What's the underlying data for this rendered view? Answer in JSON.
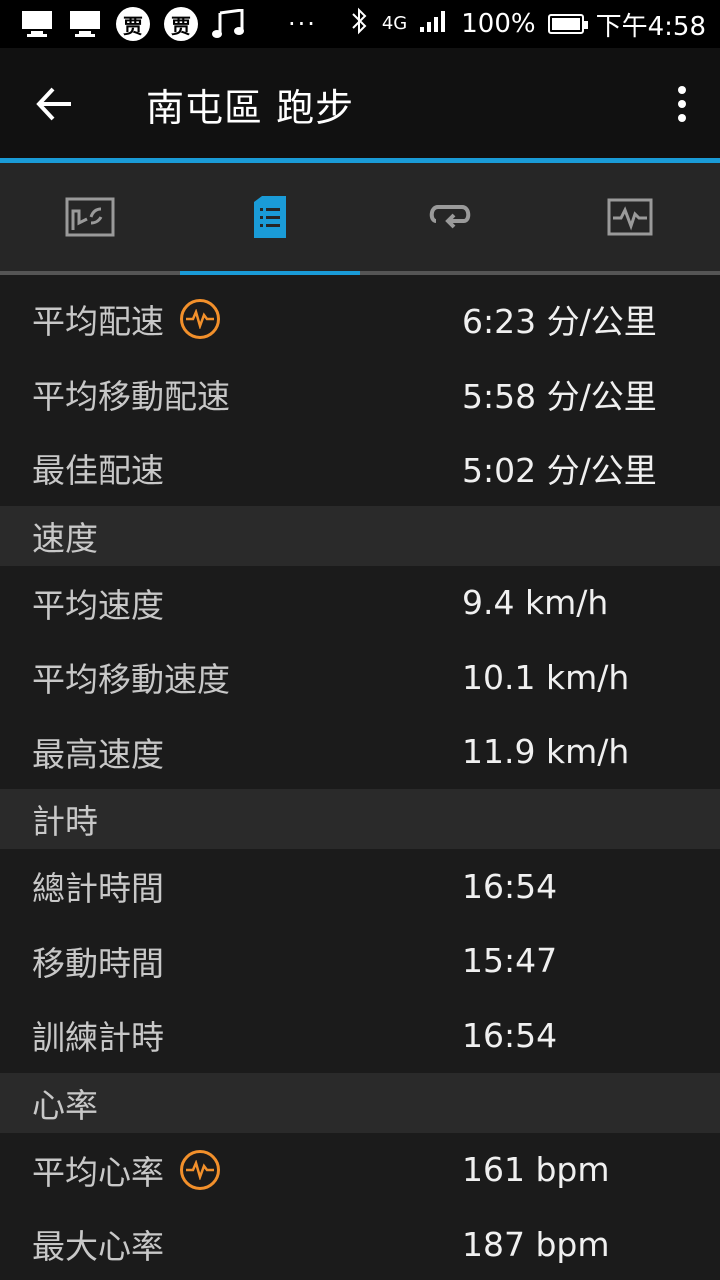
{
  "status_bar": {
    "notif_icons": [
      "monitor-icon",
      "monitor-icon",
      "coin-icon",
      "coin-icon",
      "music-note-icon"
    ],
    "coin_glyph": "贾",
    "overflow": "···",
    "network": "4G",
    "battery": "100%",
    "time": "下午4:58"
  },
  "appbar": {
    "title": "南屯區 跑步"
  },
  "tabs": [
    {
      "icon": "map-icon",
      "active": false
    },
    {
      "icon": "details-list-icon",
      "active": true
    },
    {
      "icon": "laps-loop-icon",
      "active": false
    },
    {
      "icon": "chart-icon",
      "active": false
    }
  ],
  "pace": {
    "avg_label": "平均配速",
    "avg_value": "6:23 分/公里",
    "avg_moving_label": "平均移動配速",
    "avg_moving_value": "5:58 分/公里",
    "best_label": "最佳配速",
    "best_value": "5:02 分/公里"
  },
  "speed": {
    "section": "速度",
    "avg_label": "平均速度",
    "avg_value": "9.4 km/h",
    "avg_moving_label": "平均移動速度",
    "avg_moving_value": "10.1 km/h",
    "max_label": "最高速度",
    "max_value": "11.9 km/h"
  },
  "timing": {
    "section": "計時",
    "total_label": "總計時間",
    "total_value": "16:54",
    "moving_label": "移動時間",
    "moving_value": "15:47",
    "training_label": "訓練計時",
    "training_value": "16:54"
  },
  "heart_rate": {
    "section": "心率",
    "avg_label": "平均心率",
    "avg_value": "161 bpm",
    "max_label": "最大心率",
    "max_value": "187 bpm"
  },
  "colors": {
    "accent": "#1a9bd7",
    "badge": "#f2902b"
  }
}
